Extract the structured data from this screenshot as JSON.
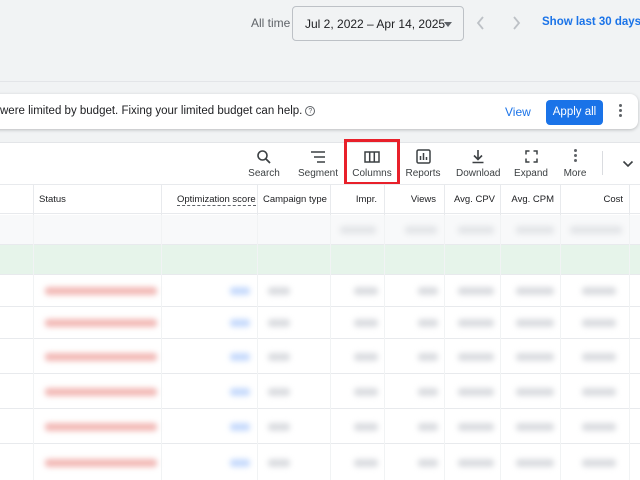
{
  "date_bar": {
    "label": "All time",
    "range": "Jul 2, 2022 – Apr 14, 2025",
    "prev_icon": "chevron-left-icon",
    "next_icon": "chevron-right-icon",
    "show_last": "Show last 30 days"
  },
  "banner": {
    "text": "were limited by budget. Fixing your limited budget can help.",
    "help_icon": "help-circle-icon",
    "view_label": "View",
    "apply_label": "Apply all"
  },
  "toolbar": {
    "search": "Search",
    "segment": "Segment",
    "columns": "Columns",
    "reports": "Reports",
    "download": "Download",
    "expand": "Expand",
    "more": "More"
  },
  "table": {
    "headers": {
      "status": "Status",
      "optimization_score": "Optimization score",
      "campaign_type": "Campaign type",
      "impr": "Impr.",
      "views": "Views",
      "avg_cpv": "Avg. CPV",
      "avg_cpm": "Avg. CPM",
      "cost": "Cost"
    },
    "row_count": 7
  },
  "colors": {
    "accent": "#1a73e8",
    "highlight": "#e8202a",
    "status_blur": "#f2b8b5",
    "green_row": "#e6f4ea"
  }
}
